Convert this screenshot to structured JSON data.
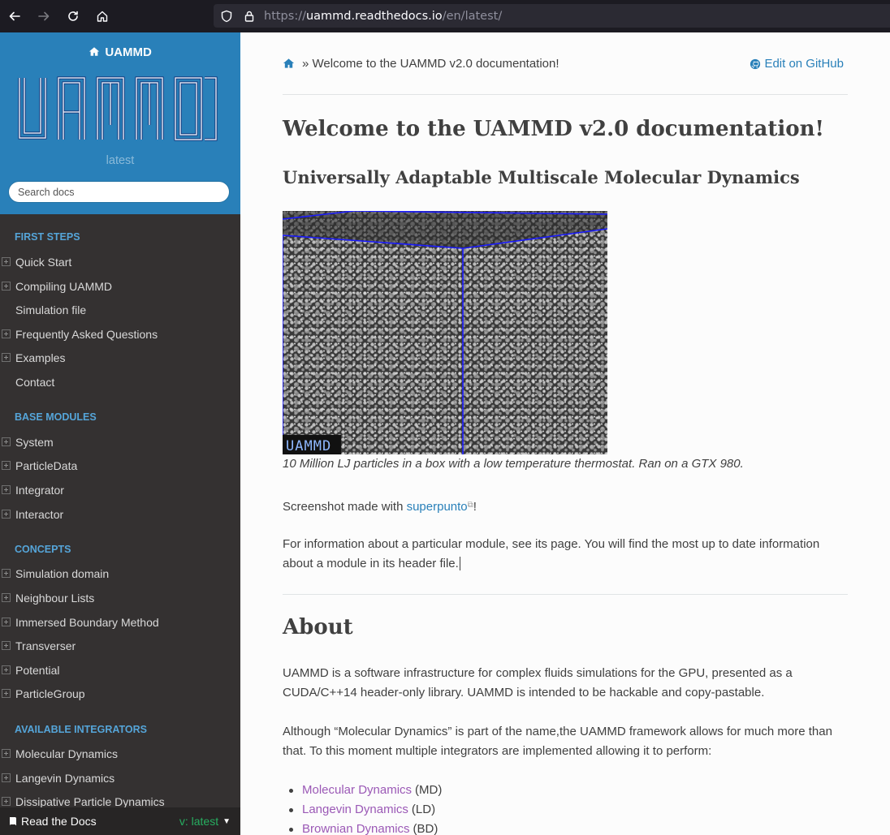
{
  "browser": {
    "url_scheme": "https://",
    "url_host": "uammd.readthedocs.io",
    "url_path": "/en/latest/"
  },
  "sidebar": {
    "project_name": "UAMMD",
    "version": "latest",
    "search_placeholder": "Search docs",
    "sections": [
      {
        "caption": "FIRST STEPS",
        "items": [
          {
            "label": "Quick Start",
            "expandable": true
          },
          {
            "label": "Compiling UAMMD",
            "expandable": true
          },
          {
            "label": "Simulation file",
            "expandable": false
          },
          {
            "label": "Frequently Asked Questions",
            "expandable": true
          },
          {
            "label": "Examples",
            "expandable": true
          },
          {
            "label": "Contact",
            "expandable": false
          }
        ]
      },
      {
        "caption": "BASE MODULES",
        "items": [
          {
            "label": "System",
            "expandable": true
          },
          {
            "label": "ParticleData",
            "expandable": true
          },
          {
            "label": "Integrator",
            "expandable": true
          },
          {
            "label": "Interactor",
            "expandable": true
          }
        ]
      },
      {
        "caption": "CONCEPTS",
        "items": [
          {
            "label": "Simulation domain",
            "expandable": true
          },
          {
            "label": "Neighbour Lists",
            "expandable": true
          },
          {
            "label": "Immersed Boundary Method",
            "expandable": true
          },
          {
            "label": "Transverser",
            "expandable": true
          },
          {
            "label": "Potential",
            "expandable": true
          },
          {
            "label": "ParticleGroup",
            "expandable": true
          }
        ]
      },
      {
        "caption": "AVAILABLE INTEGRATORS",
        "items": [
          {
            "label": "Molecular Dynamics",
            "expandable": true
          },
          {
            "label": "Langevin Dynamics",
            "expandable": true
          },
          {
            "label": "Dissipative Particle Dynamics",
            "expandable": true
          }
        ]
      }
    ],
    "rtd_label": "Read the Docs",
    "rtd_version": "v: latest"
  },
  "content": {
    "breadcrumb_current": "Welcome to the UAMMD v2.0 documentation!",
    "edit_link": "Edit on GitHub",
    "title": "Welcome to the UAMMD v2.0 documentation!",
    "subtitle": "Universally Adaptable Multiscale Molecular Dynamics",
    "figure_caption": "10 Million LJ particles in a box with a low temperature thermostat. Ran on a GTX 980.",
    "figure_watermark": "UAMMD",
    "screenshot_text": "Screenshot made with ",
    "screenshot_link": "superpunto",
    "screenshot_suffix": "!",
    "info_paragraph": "For information about a particular module, see its page. You will find the most up to date information about a module in its header file.",
    "about_heading": "About",
    "about_p1": "UAMMD is a software infrastructure for complex fluids simulations for the GPU, presented as a CUDA/C++14 header-only library. UAMMD is intended to be hackable and copy-pastable.",
    "about_p2": "Although “Molecular Dynamics” is part of the name,the UAMMD framework allows for much more than that. To this moment multiple integrators are implemented allowing it to perform:",
    "integrators": [
      {
        "name": "Molecular Dynamics",
        "abbr": "(MD)"
      },
      {
        "name": "Langevin Dynamics",
        "abbr": "(LD)"
      },
      {
        "name": "Brownian Dynamics",
        "abbr": "(BD)"
      }
    ]
  }
}
